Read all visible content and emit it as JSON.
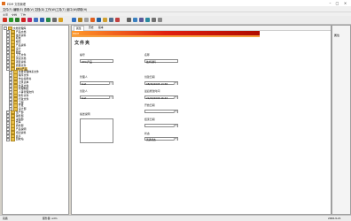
{
  "window": {
    "title": "EDM 文档管理"
  },
  "menu": [
    "文件(F)",
    "编辑(E)",
    "查看(V)",
    "文档(D)",
    "工作(W)",
    "工具(T)",
    "窗口(W)",
    "帮助(H)"
  ],
  "doc_tabs": [
    "主页",
    "文档",
    "工作"
  ],
  "toolbar_icons": [
    "new-icon",
    "add-icon",
    "check-icon",
    "delete-icon",
    "cut-icon",
    "copy-icon",
    "paste-icon",
    "refresh-icon",
    "print-icon",
    "folder-icon",
    "search-icon",
    "lock-icon",
    "unlock-icon",
    "export-icon",
    "import-icon",
    "mail-icon",
    "link-icon",
    "flag-icon",
    "attach-icon",
    "help-icon",
    "view-icon",
    "sort-icon",
    "filter-icon",
    "settings-icon"
  ],
  "tree": {
    "nodes": [
      {
        "label": "文档管理库",
        "level": 0,
        "expanded": true
      },
      {
        "label": "产品文档",
        "level": 1
      },
      {
        "label": "技术资料",
        "level": 1
      },
      {
        "label": "标准",
        "level": 1
      },
      {
        "label": "规范",
        "level": 1
      },
      {
        "label": "产品资料",
        "level": 1
      },
      {
        "label": "设计",
        "level": 1
      },
      {
        "label": "图纸",
        "level": 1
      },
      {
        "label": "工艺文件",
        "level": 1
      },
      {
        "label": "测试文档",
        "level": 1
      },
      {
        "label": "项目资料",
        "level": 1
      },
      {
        "label": "质量文件",
        "level": 1
      },
      {
        "label": "DECI产品",
        "level": 1,
        "selected": true
      },
      {
        "label": "质量管理体系文件",
        "level": 2
      },
      {
        "label": "程序文件",
        "level": 2
      },
      {
        "label": "作业指导书",
        "level": 2
      },
      {
        "label": "记录表单",
        "level": 2
      },
      {
        "label": "外来文件",
        "level": 2
      },
      {
        "label": "管理制度",
        "level": 2
      },
      {
        "label": "人事管理文件",
        "level": 2
      },
      {
        "label": "财务文件",
        "level": 2
      },
      {
        "label": "行政文件",
        "level": 2
      },
      {
        "label": "工程",
        "level": 2
      },
      {
        "label": "开发",
        "level": 2
      },
      {
        "label": "设计部",
        "level": 2
      },
      {
        "label": "生产部",
        "level": 1
      },
      {
        "label": "销售部",
        "level": 1
      },
      {
        "label": "采购部",
        "level": 1
      },
      {
        "label": "仓库",
        "level": 1
      },
      {
        "label": "质检部",
        "level": 1
      },
      {
        "label": "产品说明",
        "level": 1
      },
      {
        "label": "培训资料",
        "level": 1
      },
      {
        "label": "共享",
        "level": 1
      },
      {
        "label": "回收站",
        "level": 1
      }
    ]
  },
  "content_tabs": [
    "属性",
    "历史",
    "版本"
  ],
  "banner_logo": "EDM",
  "doc_heading": "文件夹",
  "form": {
    "code_label": "编号",
    "code_value": "DECI产品",
    "name_label": "名称",
    "name_value": "技术资料",
    "manager_label": "管理人",
    "manager_value": "test",
    "creator_label": "创建人",
    "creator_value": "test",
    "created_label": "创建日期",
    "created_value": "08/30/2005 13:58",
    "modified_label": "最后修改时间",
    "modified_value": "21/09/2006 16:43",
    "start_label": "开始日期",
    "start_value": "",
    "desc_label": "描述说明",
    "end_label": "结束日期",
    "end_value": "",
    "status_label": "状态",
    "status_value": "普通状态"
  },
  "right_panel": {
    "label": "属性"
  },
  "status": {
    "left": "就绪",
    "mid": "服务器: edm",
    "right": "2006-9-21"
  }
}
